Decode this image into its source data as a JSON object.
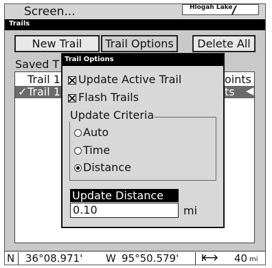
{
  "header": {
    "screen_label": "Screen...",
    "map_name": "Hlogah Lake"
  },
  "window": {
    "title": "Trails"
  },
  "toolbar": {
    "new_trail": "New Trail",
    "trail_options": "Trail Options",
    "delete_all": "Delete All"
  },
  "saved": {
    "label": "Saved T",
    "rows": [
      {
        "check": "",
        "name": "Trail 1",
        "points": "oints",
        "arrow": ""
      },
      {
        "check": "✓",
        "name": "Trail 1",
        "points": "ts",
        "arrow": "◀"
      }
    ]
  },
  "dialog": {
    "title": "Trail Options",
    "checkboxes": [
      {
        "label": "Update Active Trail",
        "checked": true
      },
      {
        "label": "Flash Trails",
        "checked": true
      }
    ],
    "criteria_label": "Update Criteria",
    "criteria_options": [
      {
        "label": "Auto",
        "selected": false
      },
      {
        "label": "Time",
        "selected": false
      },
      {
        "label": "Distance",
        "selected": true
      }
    ],
    "update_distance_label": "Update Distance",
    "update_distance_value": "0.10",
    "update_distance_unit": "mi"
  },
  "status": {
    "lat_hem": "N",
    "lat": "36°08.971'",
    "lon_hem": "W",
    "lon": "95°50.579'",
    "scale_icon": "range-arrows-icon",
    "scale": "40",
    "scale_unit": "mi"
  }
}
